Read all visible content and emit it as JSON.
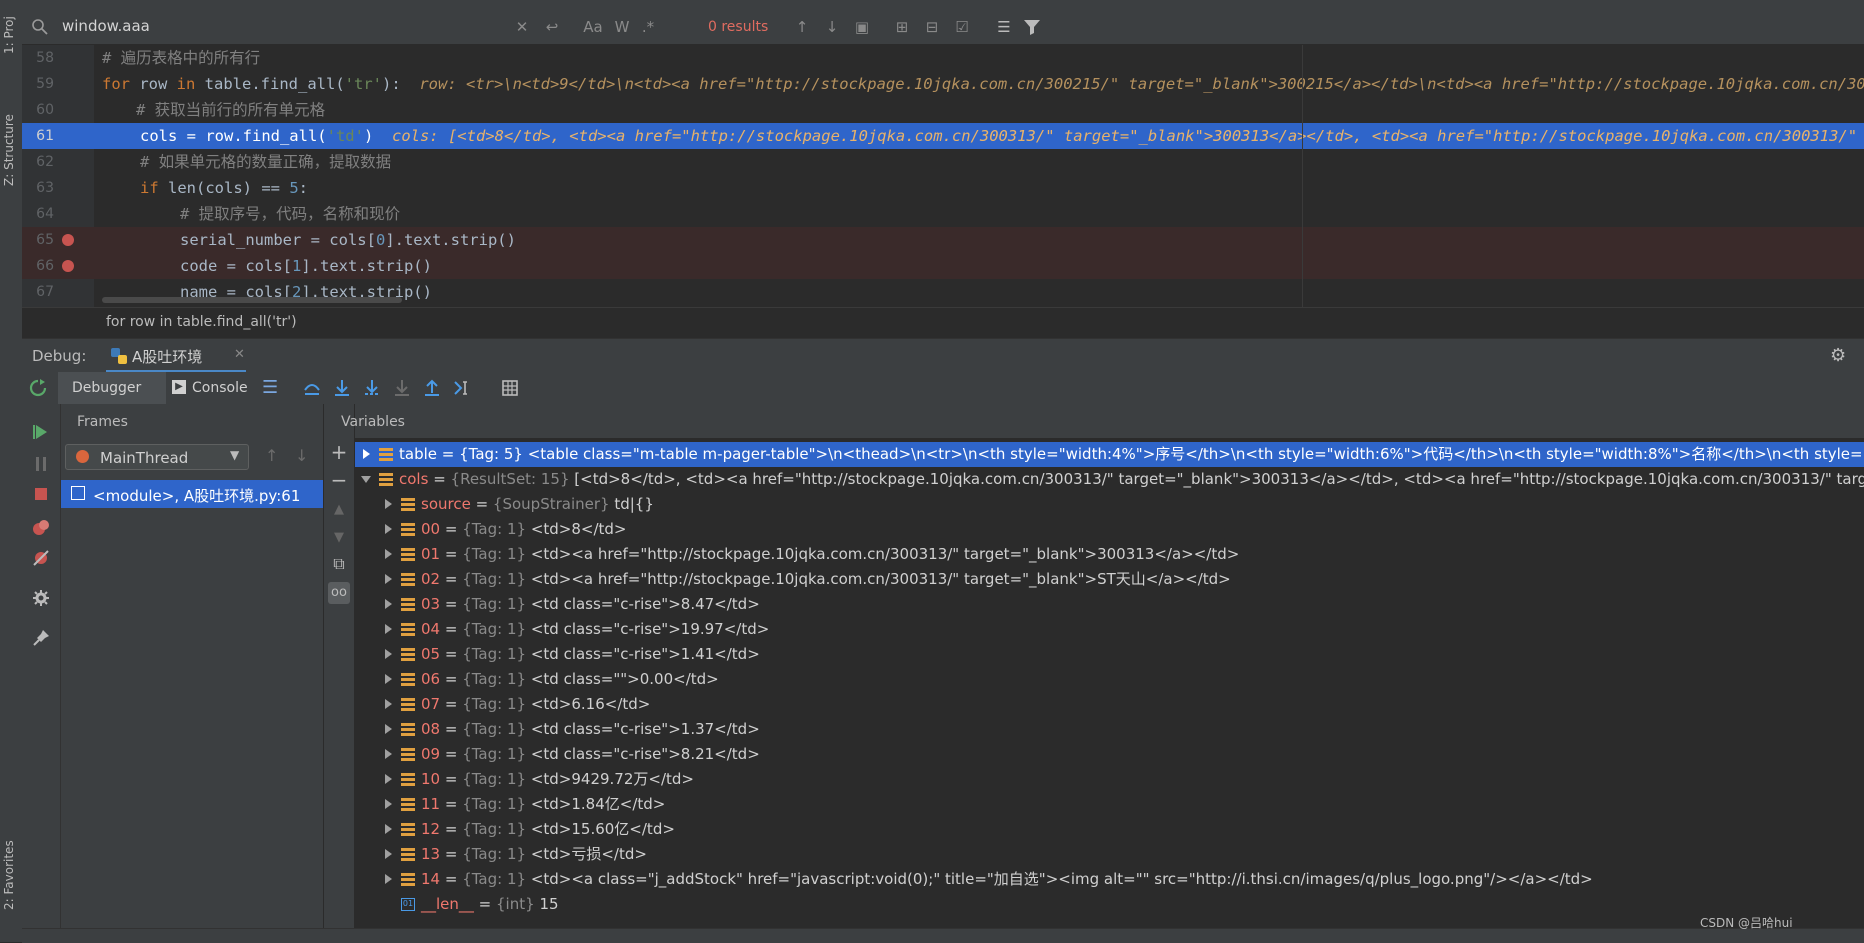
{
  "left_strip": {
    "tab_project": "1: Proj",
    "tab_structure": "Z: Structure",
    "tab_favorites": "2: Favorites"
  },
  "search": {
    "value": "window.aaa",
    "results": "0 results",
    "case_label": "Aa",
    "word_label": "W",
    "regex_label": ".*"
  },
  "editor": {
    "lines": [
      {
        "num": "58",
        "indent": 0,
        "text": "# 遍历表格中的所有行",
        "kind": "comment"
      },
      {
        "num": "59",
        "indent": 0,
        "kind": "for",
        "kw": "for",
        "pre": " row ",
        "kw2": "in",
        "post": " table.find_all(",
        "arg": "'tr'",
        "end": "):",
        "inline": "row: <tr>\\n<td>9</td>\\n<td><a href=\"http://stockpage.10jqka.com.cn/300215/\" target=\"_blank\">300215</a></td>\\n<td><a href=\"http://stockpage.10jqka.com.cn/300215/\""
      },
      {
        "num": "60",
        "indent": 1,
        "text": "# 获取当前行的所有单元格",
        "kind": "comment"
      },
      {
        "num": "61",
        "indent": 1,
        "kind": "assign",
        "pre": "cols = row.find_all(",
        "arg": "'td'",
        "end": ")",
        "inline": "cols: [<td>8</td>, <td><a href=\"http://stockpage.10jqka.com.cn/300313/\" target=\"_blank\">300313</a></td>, <td><a href=\"http://stockpage.10jqka.com.cn/300313/\""
      },
      {
        "num": "62",
        "indent": 1,
        "text": "# 如果单元格的数量正确，提取数据",
        "kind": "comment"
      },
      {
        "num": "63",
        "indent": 1,
        "kind": "if",
        "kw": "if",
        "pre": " len(cols) == ",
        "num_lit": "5",
        "end": ":"
      },
      {
        "num": "64",
        "indent": 2,
        "text": "# 提取序号，代码，名称和现价",
        "kind": "comment"
      },
      {
        "num": "65",
        "indent": 2,
        "kind": "idx",
        "pre": "serial_number = cols[",
        "num_lit": "0",
        "end": "].text.strip()"
      },
      {
        "num": "66",
        "indent": 2,
        "kind": "idx",
        "pre": "code = cols[",
        "num_lit": "1",
        "end": "].text.strip()"
      },
      {
        "num": "67",
        "indent": 2,
        "kind": "idx",
        "pre": "name = cols[",
        "num_lit": "2",
        "end": "].text.strip()"
      }
    ],
    "breadcrumb": "for row in table.find_all('tr')"
  },
  "debug": {
    "title": "Debug:",
    "config_name": "A股吐环境",
    "tab_debugger": "Debugger",
    "tab_console": "Console",
    "frames_title": "Frames",
    "thread": "MainThread",
    "frame": "<module>, A股吐环境.py:61",
    "variables_title": "Variables"
  },
  "variables": [
    {
      "level": 0,
      "expand": "collapsed",
      "name": "table",
      "type": "{Tag: 5}",
      "value": "<table class=\"m-table m-pager-table\">\\n<thead>\\n<tr>\\n<th style=\"width:4%\">序号</th>\\n<th style=\"width:6%\">代码</th>\\n<th style=\"width:8%\">名称</th>\\n<th style=\"widt"
    },
    {
      "level": 0,
      "expand": "expanded",
      "name": "cols",
      "type": "{ResultSet: 15}",
      "value": "[<td>8</td>, <td><a href=\"http://stockpage.10jqka.com.cn/300313/\" target=\"_blank\">300313</a></td>, <td><a href=\"http://stockpage.10jqka.com.cn/300313/\" target=\"_"
    },
    {
      "level": 1,
      "expand": "collapsed",
      "name": "source",
      "type": "{SoupStrainer}",
      "value": "td|{}"
    },
    {
      "level": 1,
      "expand": "collapsed",
      "name": "00",
      "type": "{Tag: 1}",
      "value": "<td>8</td>"
    },
    {
      "level": 1,
      "expand": "collapsed",
      "name": "01",
      "type": "{Tag: 1}",
      "value": "<td><a href=\"http://stockpage.10jqka.com.cn/300313/\" target=\"_blank\">300313</a></td>"
    },
    {
      "level": 1,
      "expand": "collapsed",
      "name": "02",
      "type": "{Tag: 1}",
      "value": "<td><a href=\"http://stockpage.10jqka.com.cn/300313/\" target=\"_blank\">ST天山</a></td>"
    },
    {
      "level": 1,
      "expand": "collapsed",
      "name": "03",
      "type": "{Tag: 1}",
      "value": "<td class=\"c-rise\">8.47</td>"
    },
    {
      "level": 1,
      "expand": "collapsed",
      "name": "04",
      "type": "{Tag: 1}",
      "value": "<td class=\"c-rise\">19.97</td>"
    },
    {
      "level": 1,
      "expand": "collapsed",
      "name": "05",
      "type": "{Tag: 1}",
      "value": "<td class=\"c-rise\">1.41</td>"
    },
    {
      "level": 1,
      "expand": "collapsed",
      "name": "06",
      "type": "{Tag: 1}",
      "value": "<td class=\"\">0.00</td>"
    },
    {
      "level": 1,
      "expand": "collapsed",
      "name": "07",
      "type": "{Tag: 1}",
      "value": "<td>6.16</td>"
    },
    {
      "level": 1,
      "expand": "collapsed",
      "name": "08",
      "type": "{Tag: 1}",
      "value": "<td class=\"c-rise\">1.37</td>"
    },
    {
      "level": 1,
      "expand": "collapsed",
      "name": "09",
      "type": "{Tag: 1}",
      "value": "<td class=\"c-rise\">8.21</td>"
    },
    {
      "level": 1,
      "expand": "collapsed",
      "name": "10",
      "type": "{Tag: 1}",
      "value": "<td>9429.72万</td>"
    },
    {
      "level": 1,
      "expand": "collapsed",
      "name": "11",
      "type": "{Tag: 1}",
      "value": "<td>1.84亿</td>"
    },
    {
      "level": 1,
      "expand": "collapsed",
      "name": "12",
      "type": "{Tag: 1}",
      "value": "<td>15.60亿</td>"
    },
    {
      "level": 1,
      "expand": "collapsed",
      "name": "13",
      "type": "{Tag: 1}",
      "value": "<td>亏损</td>"
    },
    {
      "level": 1,
      "expand": "collapsed",
      "name": "14",
      "type": "{Tag: 1}",
      "value": "<td><a class=\"j_addStock\" href=\"javascript:void(0);\" title=\"加自选\"><img alt=\"\" src=\"http://i.thsi.cn/images/q/plus_logo.png\"/></a></td>"
    },
    {
      "level": 1,
      "expand": "none",
      "icon": "int",
      "name": "__len__",
      "type": "{int}",
      "value": "15"
    }
  ],
  "watermark": "CSDN @吕哈hui",
  "colors": {
    "accent": "#2f65ca",
    "breakpoint": "#c75450",
    "name": "#f0786e"
  }
}
